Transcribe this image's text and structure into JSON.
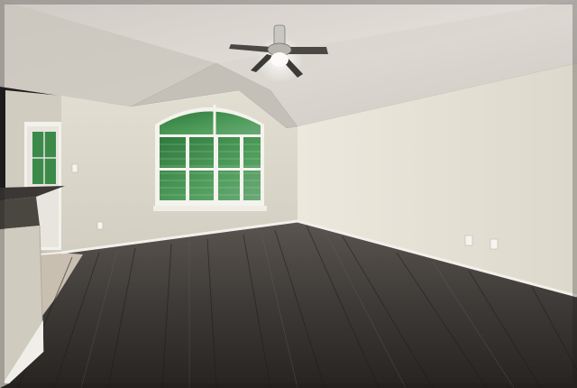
{
  "scene": {
    "subject": "empty-room-interior",
    "icons": [
      "ceiling-fan-icon",
      "arched-window-icon",
      "door-icon",
      "wall-outlet-icon",
      "light-switch-icon"
    ],
    "colors": {
      "ceiling": "#d6d2cc",
      "ceiling_shadow": "#9f9a92",
      "right_wall": "#e6e2d6",
      "back_wall": "#ddd9cd",
      "left_wall": "#d4d0c4",
      "floor_dark": "#2f2c2a",
      "floor_mid": "#4d4946",
      "floor_light": "#6a6561",
      "baseboard": "#f2f0ea",
      "window_glass": "#3f8c4e",
      "window_frame": "#f4f3ee",
      "counter_top": "#3a3734",
      "tile_floor": "#c9c0b2"
    }
  }
}
